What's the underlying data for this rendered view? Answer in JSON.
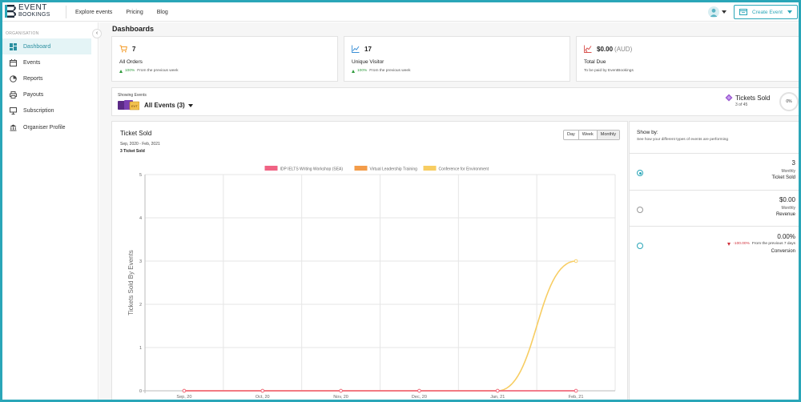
{
  "header": {
    "logo_line1": "EVENT",
    "logo_line2": "BOOKINGS",
    "nav": [
      "Explore events",
      "Pricing",
      "Blog"
    ],
    "create_button": "Create Event",
    "accent": "#2aa6b8"
  },
  "sidebar": {
    "section_label": "ORGANISATION",
    "collapse_glyph": "‹",
    "items": [
      {
        "label": "Dashboard",
        "icon": "dashboard-icon",
        "active": true
      },
      {
        "label": "Events",
        "icon": "calendar-icon",
        "active": false
      },
      {
        "label": "Reports",
        "icon": "reports-icon",
        "active": false
      },
      {
        "label": "Payouts",
        "icon": "printer-icon",
        "active": false
      },
      {
        "label": "Subscription",
        "icon": "monitor-icon",
        "active": false
      },
      {
        "label": "Organiser Profile",
        "icon": "bank-icon",
        "active": false
      }
    ]
  },
  "main": {
    "title": "Dashboards",
    "stats": [
      {
        "value": "7",
        "value_muted": "",
        "label": "All Orders",
        "change": "100%",
        "change_text": "From the previous week",
        "icon": "cart-icon"
      },
      {
        "value": "17",
        "value_muted": "",
        "label": "Unique Visitor",
        "change": "100%",
        "change_text": "From the previous week",
        "icon": "line-chart-icon"
      },
      {
        "value": "$0.00",
        "value_muted": "(AUD)",
        "label": "Total Due",
        "change": "",
        "change_text": "To be paid by EventBookings",
        "icon": "revenue-chart-icon"
      }
    ],
    "events_bar": {
      "showing_label": "Showing Events",
      "selected": "All Events (3)",
      "tickets_title": "Tickets Sold",
      "tickets_of": "3 of 45",
      "percent": "0%"
    },
    "chart_card": {
      "title": "Ticket Sold",
      "range": "Sep, 2020 - Feb, 2021",
      "count": "3 Ticket Sold",
      "periods": [
        "Day",
        "Week",
        "Monthly"
      ]
    },
    "show_by": {
      "title": "Show by:",
      "description": "See how your different types of events are performing",
      "rows": [
        {
          "value": "3",
          "period": "Monthly",
          "name": "Ticket Sold",
          "checked": true
        },
        {
          "value": "$0.00",
          "period": "Monthly",
          "name": "Revenue",
          "checked": false
        },
        {
          "value": "0.00%",
          "change": "-100.00%",
          "change_text": "From the previous 7 days",
          "name": "Conversion",
          "checked": false
        }
      ]
    }
  },
  "chart_data": {
    "type": "line",
    "title": "",
    "ylabel": "Tickets Sold By Events",
    "xlabel": "",
    "categories": [
      "Sep, 20",
      "Oct, 20",
      "Nov, 20",
      "Dec, 20",
      "Jan, 21",
      "Feb, 21"
    ],
    "ylim": [
      0,
      5
    ],
    "yticks": [
      0,
      1,
      2,
      3,
      4,
      5
    ],
    "grid": true,
    "legend": "top-center",
    "series": [
      {
        "name": "IDP IELTS Writing Workshop (SEA)",
        "color": "#f06384",
        "values": [
          0,
          0,
          0,
          0,
          0,
          0
        ]
      },
      {
        "name": "Virtual Leadership Training",
        "color": "#f39c4a",
        "values": [
          0,
          0,
          0,
          0,
          0,
          0
        ]
      },
      {
        "name": "Conference for Environment",
        "color": "#f7cd62",
        "values": [
          0,
          0,
          0,
          0,
          0,
          3
        ]
      }
    ]
  }
}
